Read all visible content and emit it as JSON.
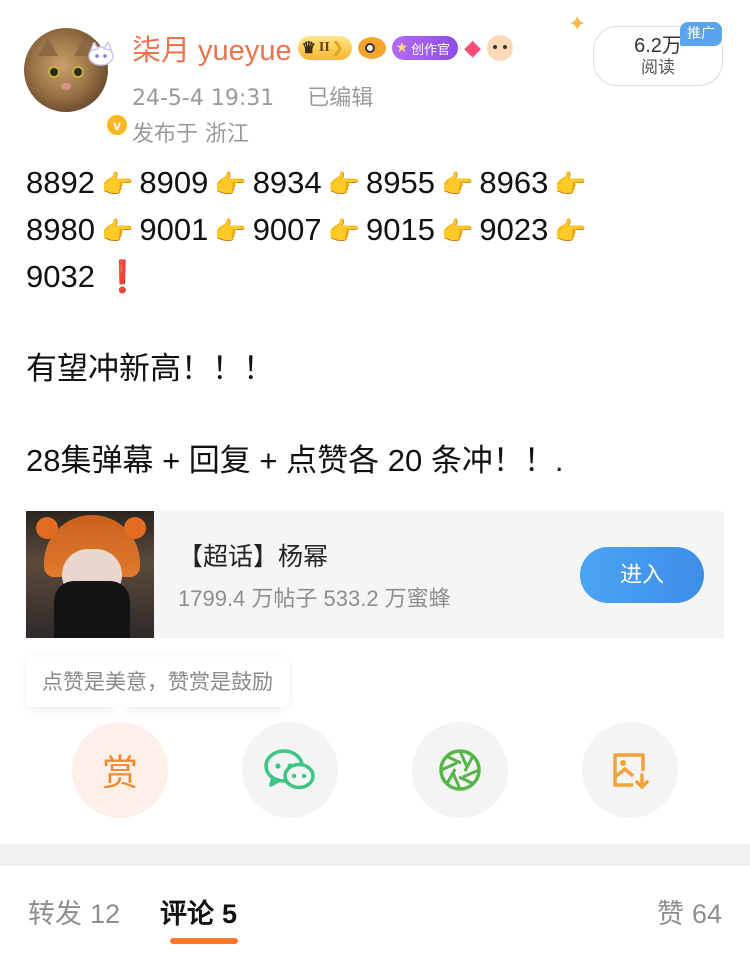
{
  "header": {
    "username": "柒月 yueyue",
    "rank_badge": "II",
    "creator_badge": "创作官",
    "date": "24-5-4 19:31",
    "edited": "已编辑",
    "location": "发布于 浙江",
    "reads_count": "6.2万",
    "reads_label": "阅读",
    "promo_label": "推广",
    "verified_mark": "v"
  },
  "post": {
    "row1": [
      "8892",
      "8909",
      "8934",
      "8955",
      "8963"
    ],
    "row2": [
      "8980",
      "9001",
      "9007",
      "9015",
      "9023"
    ],
    "row3": "9032",
    "hand_glyph": "👉",
    "excl_glyph": "❗",
    "line4": "有望冲新高！！！",
    "line5": "28集弹幕 + 回复 + 点赞各 20 条冲！！."
  },
  "topic": {
    "title": "【超话】杨幂",
    "stats": "1799.4 万帖子  533.2 万蜜蜂",
    "enter_label": "进入"
  },
  "reward": {
    "tip": "点赞是美意，赞赏是鼓励",
    "reward_char": "赏"
  },
  "tabs": {
    "repost_label": "转发",
    "repost_count": "12",
    "comment_label": "评论",
    "comment_count": "5",
    "like_label": "赞",
    "like_count": "64"
  },
  "colors": {
    "username": "#eb7350",
    "accent_orange": "#ff7a2a",
    "enter_button": "#4aa4f4",
    "wechat_green": "#3cc583",
    "moments_green": "#56b549",
    "save_orange": "#f4a13a"
  }
}
